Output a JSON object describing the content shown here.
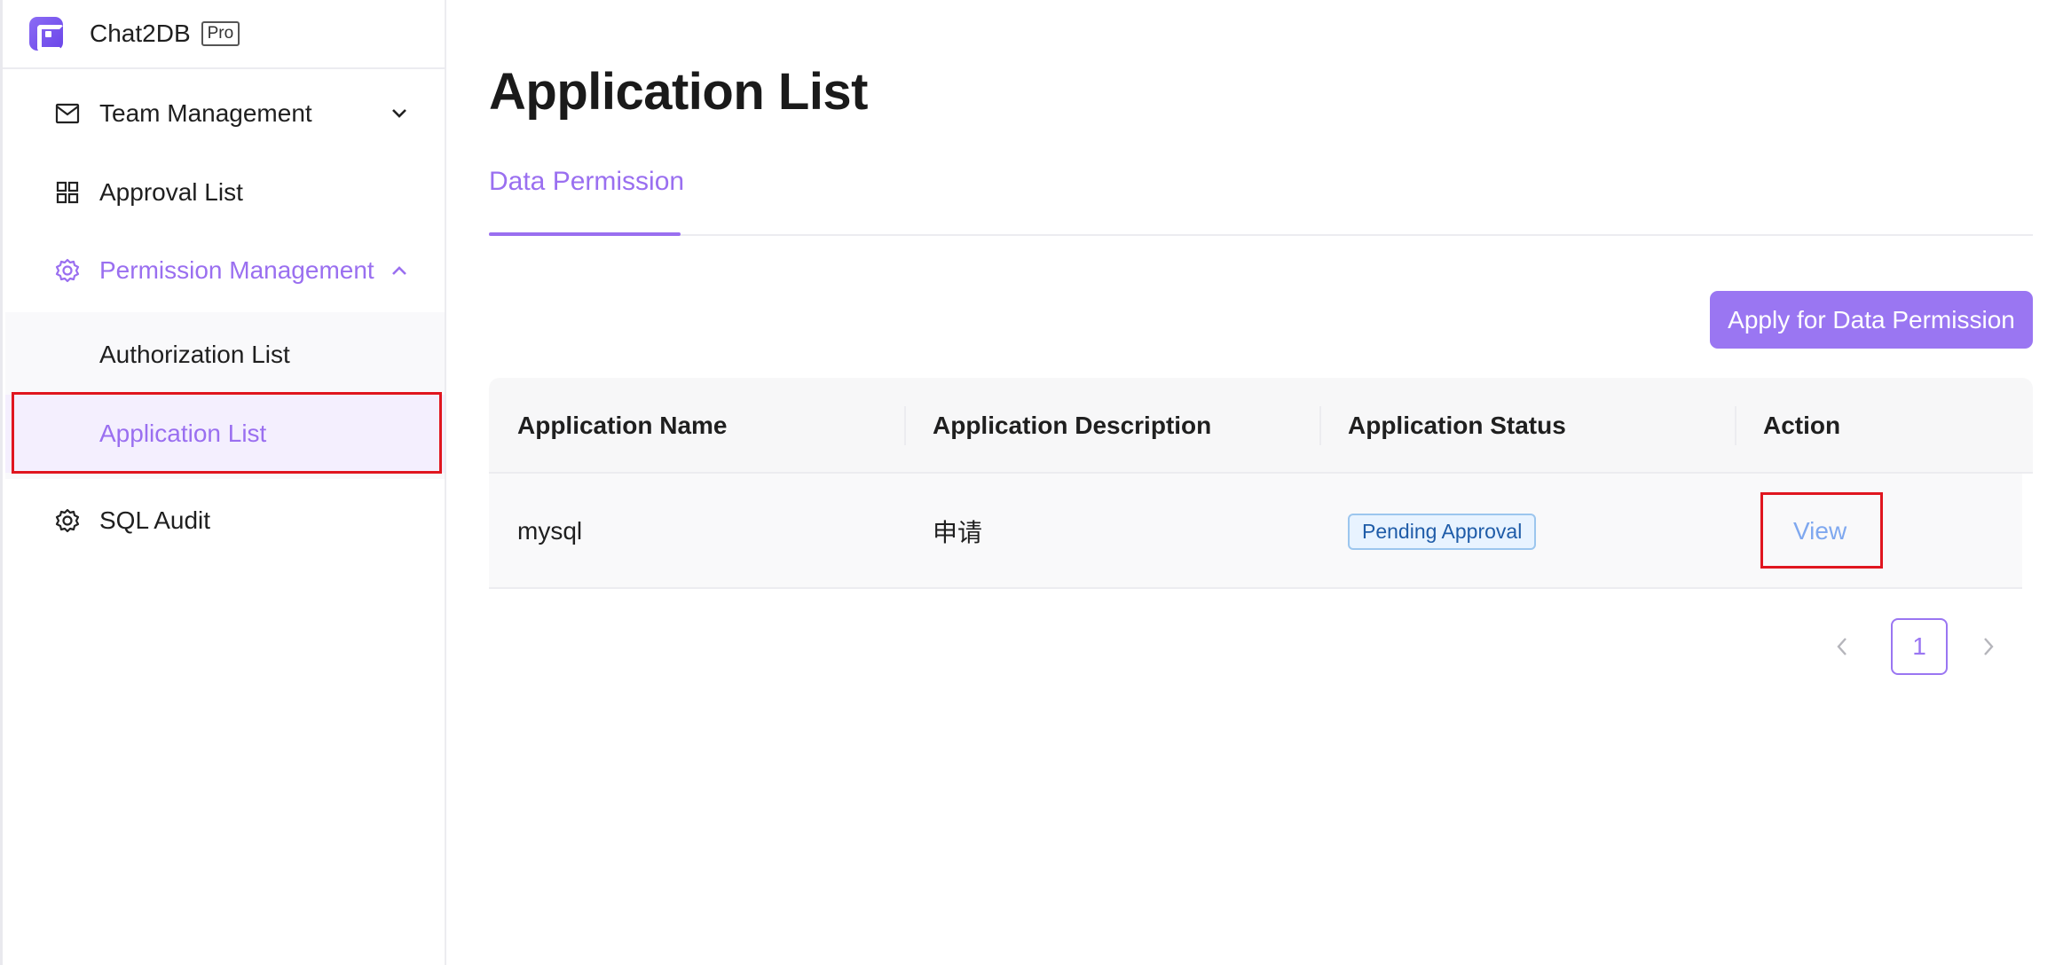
{
  "app": {
    "name": "Chat2DB",
    "badge": "Pro"
  },
  "sidebar": {
    "items": [
      {
        "label": "Team Management",
        "icon": "mail-icon",
        "expanded": false
      },
      {
        "label": "Approval List",
        "icon": "grid-icon"
      },
      {
        "label": "Permission Management",
        "icon": "gear-icon",
        "expanded": true
      },
      {
        "label": "SQL Audit",
        "icon": "gear-icon"
      }
    ],
    "sub_items": [
      {
        "label": "Authorization List"
      },
      {
        "label": "Application List",
        "selected": true
      }
    ]
  },
  "main": {
    "title": "Application List",
    "tabs": [
      {
        "label": "Data Permission",
        "active": true
      }
    ],
    "apply_button": "Apply for Data Permission",
    "table": {
      "columns": [
        "Application Name",
        "Application Description",
        "Application Status",
        "Action"
      ],
      "rows": [
        {
          "name": "mysql",
          "description": "申请",
          "status": "Pending Approval",
          "action": "View"
        }
      ]
    },
    "pagination": {
      "current_page": "1"
    }
  },
  "colors": {
    "accent": "#9a6ff0",
    "highlight_box": "#e0161f",
    "status_text": "#1f5ca8"
  }
}
